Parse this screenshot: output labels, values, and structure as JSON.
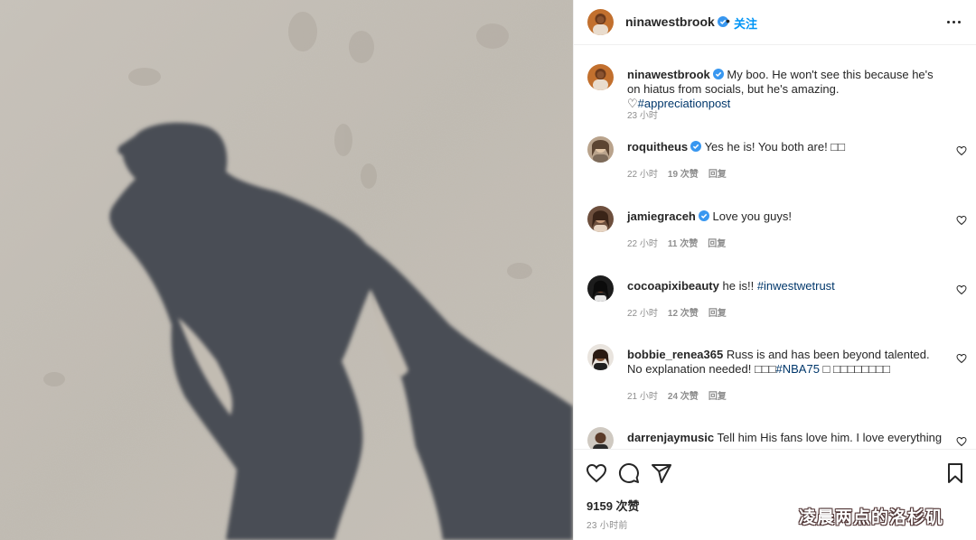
{
  "post": {
    "username": "ninawestbrook",
    "follow_label": "关注",
    "separator": "•"
  },
  "caption": {
    "username": "ninawestbrook",
    "text": "My boo. He won't see this because he's on hiatus from socials, but he's amazing. ♡",
    "hashtag": "#appreciationpost",
    "time": "23 小时"
  },
  "comments": [
    {
      "username": "roquitheus",
      "verified": true,
      "text": "Yes he is! You both are! □□",
      "hashtag": "",
      "time": "22 小时",
      "likes": "19 次赞",
      "reply": "回复"
    },
    {
      "username": "jamiegraceh",
      "verified": true,
      "text": "Love you guys!",
      "hashtag": "",
      "time": "22 小时",
      "likes": "11 次赞",
      "reply": "回复"
    },
    {
      "username": "cocoapixibeauty",
      "verified": false,
      "text": "he is!!",
      "hashtag": "#inwestwetrust",
      "time": "22 小时",
      "likes": "12 次赞",
      "reply": "回复"
    },
    {
      "username": "bobbie_renea365",
      "verified": false,
      "text": "Russ is and has been beyond talented. No explanation needed! □□□",
      "hashtag": "#NBA75",
      "suffix": " □ □□□□□□□□",
      "time": "21 小时",
      "likes": "24 次赞",
      "reply": "回复"
    },
    {
      "username": "darrenjaymusic",
      "verified": false,
      "text": "Tell him His fans love him. I love everything"
    }
  ],
  "footer": {
    "likes": "9159 次赞",
    "time": "23 小时前"
  },
  "watermark": "凌晨两点的洛杉矶",
  "colors": {
    "link": "#0095f6",
    "hashtag": "#00376b",
    "muted": "#8e8e8e",
    "text": "#262626"
  },
  "icons": [
    "verified-badge-icon",
    "more-options-icon",
    "heart-icon",
    "comment-icon",
    "share-icon",
    "bookmark-icon"
  ]
}
